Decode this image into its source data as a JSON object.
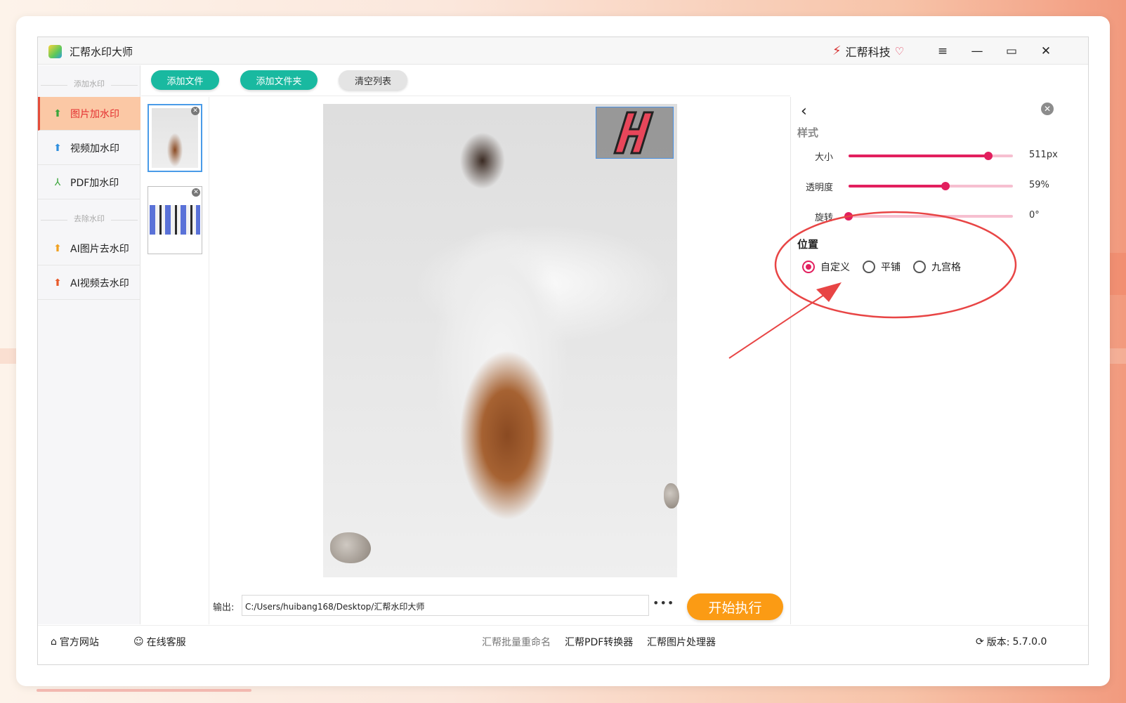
{
  "app": {
    "title": "汇帮水印大师",
    "brand_name": "汇帮科技"
  },
  "window_controls": {
    "menu_icon": "≡",
    "minimize_icon": "—",
    "maximize_icon": "▭",
    "close_icon": "✕"
  },
  "sidebar": {
    "section_add": "添加水印",
    "section_remove": "去除水印",
    "items": [
      {
        "label": "图片加水印",
        "icon": "image-stamp-icon",
        "active": true
      },
      {
        "label": "视频加水印",
        "icon": "video-stamp-icon",
        "active": false
      },
      {
        "label": "PDF加水印",
        "icon": "pdf-icon",
        "active": false
      },
      {
        "label": "AI图片去水印",
        "icon": "ai-image-remove-icon",
        "active": false
      },
      {
        "label": "AI视频去水印",
        "icon": "ai-video-remove-icon",
        "active": false
      }
    ]
  },
  "toolbar": {
    "add_file": "添加文件",
    "add_folder": "添加文件夹",
    "clear_list": "清空列表"
  },
  "output": {
    "label": "输出:",
    "path": "C:/Users/huibang168/Desktop/汇帮水印大师",
    "more": "•••",
    "start": "开始执行"
  },
  "panel": {
    "style_title": "样式",
    "sliders": [
      {
        "label": "大小",
        "value": "511px",
        "level": 0.85
      },
      {
        "label": "透明度",
        "value": "59%",
        "level": 0.59
      },
      {
        "label": "旋转",
        "value": "0°",
        "level": 0.0
      }
    ],
    "position_title": "位置",
    "position_options": [
      {
        "label": "自定义",
        "selected": true
      },
      {
        "label": "平铺",
        "selected": false
      },
      {
        "label": "九宫格",
        "selected": false
      }
    ]
  },
  "footer": {
    "website": "官方网站",
    "support": "在线客服",
    "links": [
      "汇帮批量重命名",
      "汇帮PDF转换器",
      "汇帮图片处理器"
    ],
    "version_label": "版本:",
    "version": "5.7.0.0"
  },
  "colors": {
    "accent": "#e21f5e",
    "teal": "#19b9a0",
    "orange": "#fb9b14",
    "annotation": "#e84545"
  }
}
